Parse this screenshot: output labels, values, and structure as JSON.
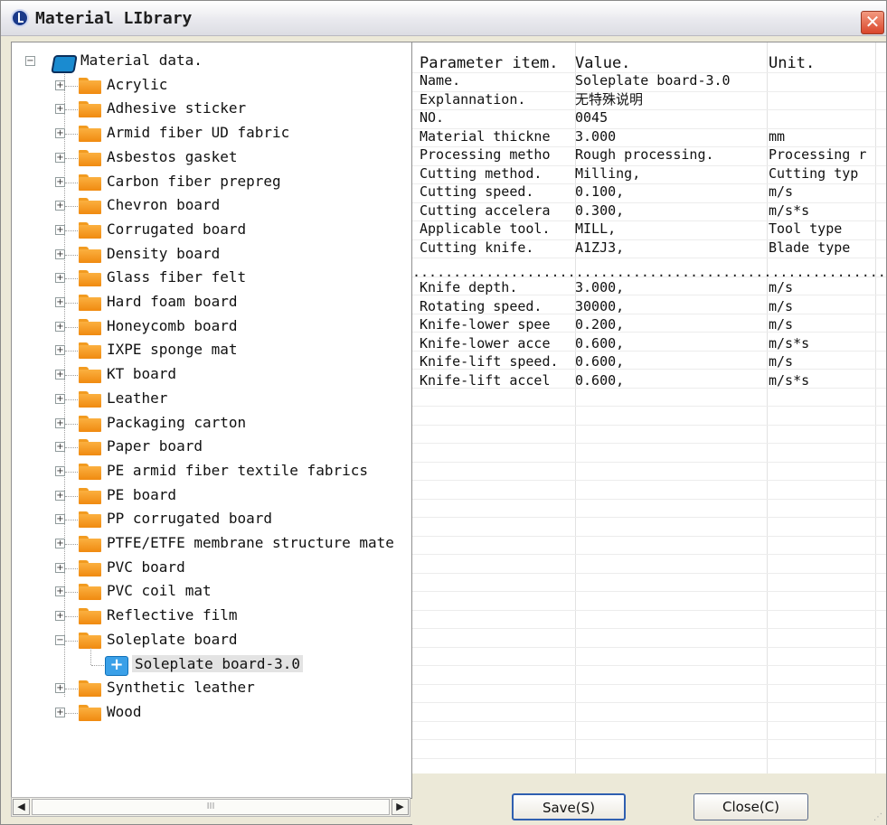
{
  "window": {
    "title": "Material LIbrary"
  },
  "tree": {
    "root_label": "Material data.",
    "categories": [
      "Acrylic",
      "Adhesive sticker",
      "Armid fiber UD fabric",
      "Asbestos gasket",
      "Carbon fiber prepreg",
      "Chevron board",
      "Corrugated board",
      "Density board",
      "Glass fiber felt",
      "Hard foam board",
      "Honeycomb board",
      "IXPE sponge mat",
      "KT board",
      "Leather",
      "Packaging carton",
      "Paper board",
      "PE armid fiber textile fabrics",
      "PE board",
      "PP corrugated board",
      "PTFE/ETFE membrane structure mate",
      "PVC board",
      "PVC coil mat",
      "Reflective film",
      "Soleplate board",
      "Synthetic leather",
      "Wood"
    ],
    "expanded_category": "Soleplate board",
    "selected_item": "Soleplate board-3.0"
  },
  "scrollbar": {
    "thumb_grip": "III"
  },
  "grid": {
    "headers": [
      "Parameter item.",
      "Value.",
      "Unit."
    ],
    "rows_top": [
      [
        "Name.",
        "Soleplate board-3.0",
        ""
      ],
      [
        "Explannation.",
        "无特殊说明",
        ""
      ],
      [
        "NO.",
        "0045",
        ""
      ],
      [
        "Material thickne",
        "3.000",
        "mm"
      ],
      [
        "Processing metho",
        "Rough processing.",
        "Processing r"
      ],
      [
        "Cutting method.",
        "Milling,",
        "Cutting typ"
      ],
      [
        "Cutting speed.",
        "0.100,",
        "m/s"
      ],
      [
        "Cutting accelera",
        "0.300,",
        "m/s*s"
      ],
      [
        "Applicable tool.",
        "MILL,",
        "Tool type"
      ],
      [
        "Cutting knife.",
        "A1ZJ3,",
        "Blade type"
      ]
    ],
    "separator": "........................................................................",
    "rows_bottom": [
      [
        "Knife depth.",
        "3.000,",
        "m/s"
      ],
      [
        "Rotating speed.",
        "30000,",
        "m/s"
      ],
      [
        "Knife-lower spee",
        "0.200,",
        "m/s"
      ],
      [
        "Knife-lower acce",
        "0.600,",
        "m/s*s"
      ],
      [
        "Knife-lift speed.",
        "0.600,",
        "m/s"
      ],
      [
        "Knife-lift accel",
        "0.600,",
        "m/s*s"
      ]
    ]
  },
  "buttons": {
    "save": "Save(S)",
    "close": "Close(C)"
  }
}
